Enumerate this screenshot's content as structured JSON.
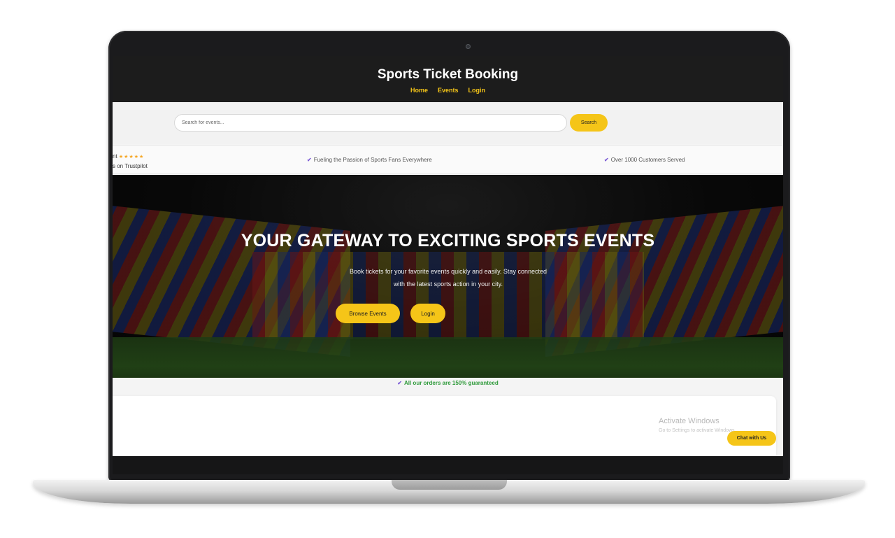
{
  "header": {
    "title": "Sports Ticket Booking",
    "nav": [
      "Home",
      "Events",
      "Login"
    ]
  },
  "search": {
    "placeholder": "Search for events...",
    "button_label": "Search"
  },
  "trust_bar": {
    "rating_text": "nt",
    "stars": "★★★★★",
    "reviews_text": "s on Trustpilot",
    "item_1": "Fueling the Passion of Sports Fans Everywhere",
    "item_2": "Over 1000 Customers Served"
  },
  "hero": {
    "title": "YOUR GATEWAY TO EXCITING SPORTS EVENTS",
    "text_line_1": "Book tickets for your favorite events quickly and easily. Stay connected",
    "text_line_2": "with the latest sports action in your city.",
    "browse_button": "Browse Events",
    "login_button": "Login"
  },
  "guarantee": "All our orders are 150% guaranteed",
  "overlay": {
    "activate_title": "Activate Windows",
    "activate_sub": "Go to Settings to activate Windows.",
    "chat_button": "Chat with Us"
  },
  "colors": {
    "accent": "#f5c518",
    "header_bg": "#1c1c1c",
    "check": "#7c5cd6",
    "guarantee": "#2e9a3a"
  },
  "icons": {
    "check": "check-icon",
    "star": "star-icon",
    "camera": "camera-icon"
  }
}
